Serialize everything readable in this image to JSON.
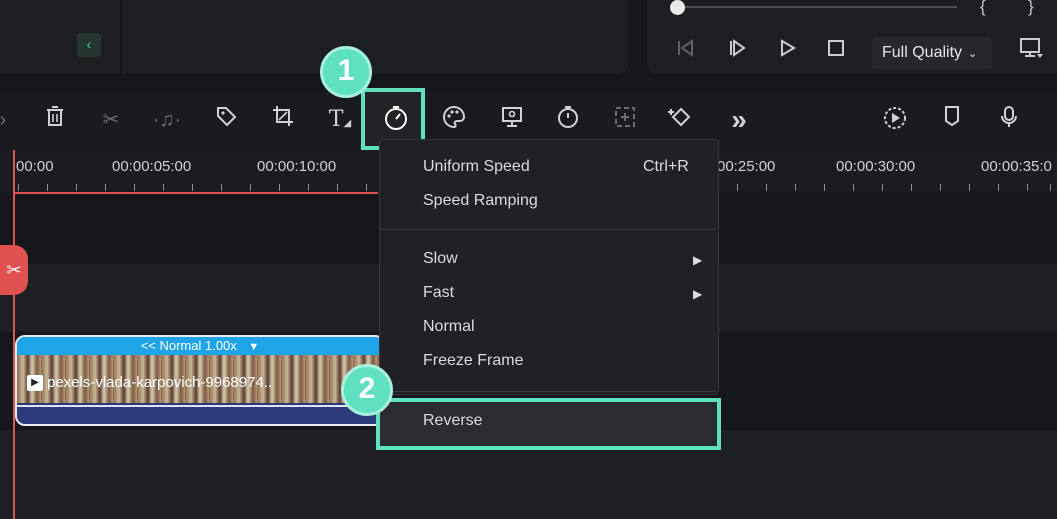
{
  "player": {
    "brace_left": "{",
    "brace_right": "}",
    "quality_label": "Full Quality"
  },
  "toolbar": {
    "icons": [
      "chevron-right-icon",
      "delete-icon",
      "cut-icon",
      "audio-detach-icon",
      "tag-icon",
      "crop-icon",
      "text-icon",
      "speed-icon",
      "color-palette-icon",
      "green-screen-icon",
      "timer-icon",
      "add-frame-icon",
      "keyframe-icon",
      "more-icon",
      "auto-beat-icon",
      "marker-icon",
      "microphone-icon"
    ]
  },
  "annotations": {
    "step1": "1",
    "step2": "2"
  },
  "ruler": {
    "labels": [
      "00:00",
      "00:00:05:00",
      "00:00:10:00",
      "00:25:00",
      "00:00:30:00",
      "00:00:35:0"
    ]
  },
  "clip": {
    "speed_label": "<< Normal 1.00x",
    "speed_caret": "▼",
    "name": "pexels-vlada-karpovich-9968974.."
  },
  "speed_menu": {
    "uniform_speed": "Uniform Speed",
    "uniform_speed_shortcut": "Ctrl+R",
    "speed_ramping": "Speed Ramping",
    "slow": "Slow",
    "fast": "Fast",
    "normal": "Normal",
    "freeze_frame": "Freeze Frame",
    "reverse": "Reverse"
  },
  "colors": {
    "accent_teal": "#5ee0c1",
    "playhead_red": "#e0524f",
    "clip_blue": "#1fa4e8"
  }
}
